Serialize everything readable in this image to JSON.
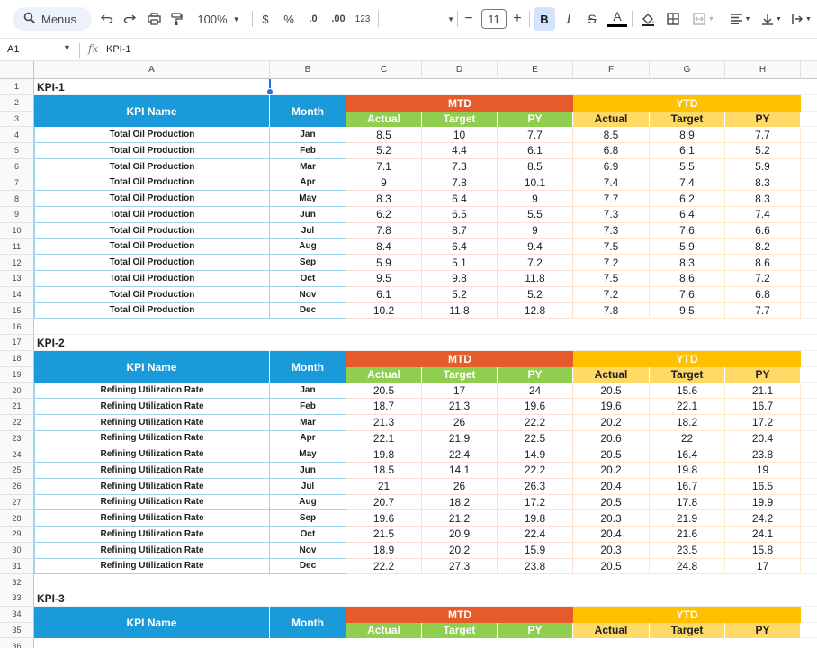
{
  "toolbar": {
    "menus_label": "Menus",
    "zoom": "100%",
    "currency": "$",
    "percent": "%",
    "dec_decrease": ".0",
    "dec_increase": ".00",
    "number_format": "123",
    "font_size": "11",
    "bold": "B",
    "italic": "I",
    "strike": "S",
    "text_color": "A",
    "minus": "−",
    "plus": "+"
  },
  "formula_bar": {
    "cell_ref": "A1",
    "fx": "fx",
    "content": "KPI-1"
  },
  "columns": [
    "A",
    "B",
    "C",
    "D",
    "E",
    "F",
    "G",
    "H"
  ],
  "headers": {
    "kpi_name": "KPI Name",
    "month": "Month",
    "mtd": "MTD",
    "ytd": "YTD",
    "actual": "Actual",
    "target": "Target",
    "py": "PY"
  },
  "tables": [
    {
      "title": "KPI-1",
      "name": "Total Oil Production",
      "rows": [
        {
          "month": "Jan",
          "mtd": [
            "8.5",
            "10",
            "7.7"
          ],
          "ytd": [
            "8.5",
            "8.9",
            "7.7"
          ]
        },
        {
          "month": "Feb",
          "mtd": [
            "5.2",
            "4.4",
            "6.1"
          ],
          "ytd": [
            "6.8",
            "6.1",
            "5.2"
          ]
        },
        {
          "month": "Mar",
          "mtd": [
            "7.1",
            "7.3",
            "8.5"
          ],
          "ytd": [
            "6.9",
            "5.5",
            "5.9"
          ]
        },
        {
          "month": "Apr",
          "mtd": [
            "9",
            "7.8",
            "10.1"
          ],
          "ytd": [
            "7.4",
            "7.4",
            "8.3"
          ]
        },
        {
          "month": "May",
          "mtd": [
            "8.3",
            "6.4",
            "9"
          ],
          "ytd": [
            "7.7",
            "6.2",
            "8.3"
          ]
        },
        {
          "month": "Jun",
          "mtd": [
            "6.2",
            "6.5",
            "5.5"
          ],
          "ytd": [
            "7.3",
            "6.4",
            "7.4"
          ]
        },
        {
          "month": "Jul",
          "mtd": [
            "7.8",
            "8.7",
            "9"
          ],
          "ytd": [
            "7.3",
            "7.6",
            "6.6"
          ]
        },
        {
          "month": "Aug",
          "mtd": [
            "8.4",
            "6.4",
            "9.4"
          ],
          "ytd": [
            "7.5",
            "5.9",
            "8.2"
          ]
        },
        {
          "month": "Sep",
          "mtd": [
            "5.9",
            "5.1",
            "7.2"
          ],
          "ytd": [
            "7.2",
            "8.3",
            "8.6"
          ]
        },
        {
          "month": "Oct",
          "mtd": [
            "9.5",
            "9.8",
            "11.8"
          ],
          "ytd": [
            "7.5",
            "8.6",
            "7.2"
          ]
        },
        {
          "month": "Nov",
          "mtd": [
            "6.1",
            "5.2",
            "5.2"
          ],
          "ytd": [
            "7.2",
            "7.6",
            "6.8"
          ]
        },
        {
          "month": "Dec",
          "mtd": [
            "10.2",
            "11.8",
            "12.8"
          ],
          "ytd": [
            "7.8",
            "9.5",
            "7.7"
          ]
        }
      ]
    },
    {
      "title": "KPI-2",
      "name": "Refining Utilization Rate",
      "rows": [
        {
          "month": "Jan",
          "mtd": [
            "20.5",
            "17",
            "24"
          ],
          "ytd": [
            "20.5",
            "15.6",
            "21.1"
          ]
        },
        {
          "month": "Feb",
          "mtd": [
            "18.7",
            "21.3",
            "19.6"
          ],
          "ytd": [
            "19.6",
            "22.1",
            "16.7"
          ]
        },
        {
          "month": "Mar",
          "mtd": [
            "21.3",
            "26",
            "22.2"
          ],
          "ytd": [
            "20.2",
            "18.2",
            "17.2"
          ]
        },
        {
          "month": "Apr",
          "mtd": [
            "22.1",
            "21.9",
            "22.5"
          ],
          "ytd": [
            "20.6",
            "22",
            "20.4"
          ]
        },
        {
          "month": "May",
          "mtd": [
            "19.8",
            "22.4",
            "14.9"
          ],
          "ytd": [
            "20.5",
            "16.4",
            "23.8"
          ]
        },
        {
          "month": "Jun",
          "mtd": [
            "18.5",
            "14.1",
            "22.2"
          ],
          "ytd": [
            "20.2",
            "19.8",
            "19"
          ]
        },
        {
          "month": "Jul",
          "mtd": [
            "21",
            "26",
            "26.3"
          ],
          "ytd": [
            "20.4",
            "16.7",
            "16.5"
          ]
        },
        {
          "month": "Aug",
          "mtd": [
            "20.7",
            "18.2",
            "17.2"
          ],
          "ytd": [
            "20.5",
            "17.8",
            "19.9"
          ]
        },
        {
          "month": "Sep",
          "mtd": [
            "19.6",
            "21.2",
            "19.8"
          ],
          "ytd": [
            "20.3",
            "21.9",
            "24.2"
          ]
        },
        {
          "month": "Oct",
          "mtd": [
            "21.5",
            "20.9",
            "22.4"
          ],
          "ytd": [
            "20.4",
            "21.6",
            "24.1"
          ]
        },
        {
          "month": "Nov",
          "mtd": [
            "18.9",
            "20.2",
            "15.9"
          ],
          "ytd": [
            "20.3",
            "23.5",
            "15.8"
          ]
        },
        {
          "month": "Dec",
          "mtd": [
            "22.2",
            "27.3",
            "23.8"
          ],
          "ytd": [
            "20.5",
            "24.8",
            "17"
          ]
        }
      ]
    },
    {
      "title": "KPI-3",
      "name": "",
      "rows": []
    }
  ],
  "colors": {
    "kpi_header": "#1a9ad8",
    "mtd_header": "#e55b2a",
    "ytd_header": "#ffc000",
    "mtd_sub": "#8fce4f",
    "ytd_sub": "#ffd966",
    "selection": "#1a73e8"
  }
}
